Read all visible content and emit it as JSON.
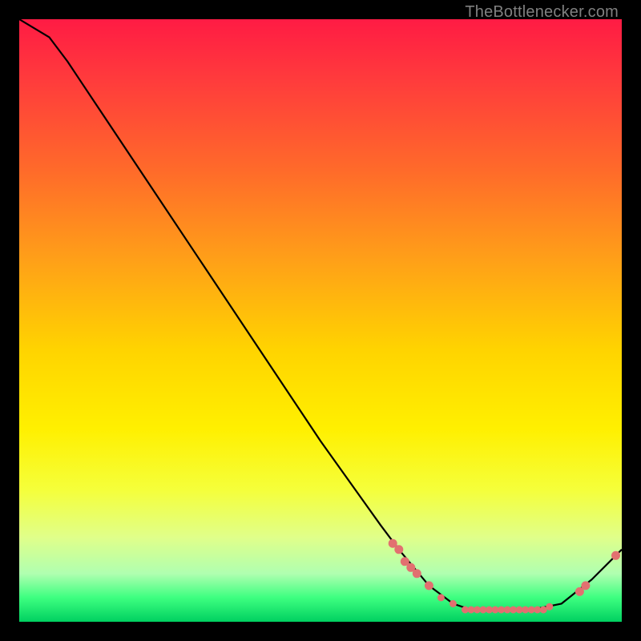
{
  "attribution": "TheBottlenecker.com",
  "chart_data": {
    "type": "line",
    "title": "",
    "xlabel": "",
    "ylabel": "",
    "xlim": [
      0,
      100
    ],
    "ylim": [
      0,
      100
    ],
    "curve": [
      {
        "x": 0,
        "y": 100
      },
      {
        "x": 5,
        "y": 97
      },
      {
        "x": 8,
        "y": 93
      },
      {
        "x": 10,
        "y": 90
      },
      {
        "x": 20,
        "y": 75
      },
      {
        "x": 30,
        "y": 60
      },
      {
        "x": 40,
        "y": 45
      },
      {
        "x": 50,
        "y": 30
      },
      {
        "x": 60,
        "y": 16
      },
      {
        "x": 63,
        "y": 12
      },
      {
        "x": 68,
        "y": 6
      },
      {
        "x": 72,
        "y": 3
      },
      {
        "x": 75,
        "y": 2
      },
      {
        "x": 80,
        "y": 2
      },
      {
        "x": 85,
        "y": 2
      },
      {
        "x": 90,
        "y": 3
      },
      {
        "x": 95,
        "y": 7
      },
      {
        "x": 98,
        "y": 10
      },
      {
        "x": 100,
        "y": 12
      }
    ],
    "markers": [
      {
        "x": 62,
        "y": 13,
        "r": 5
      },
      {
        "x": 63,
        "y": 12,
        "r": 5
      },
      {
        "x": 64,
        "y": 10,
        "r": 5
      },
      {
        "x": 65,
        "y": 9,
        "r": 5
      },
      {
        "x": 66,
        "y": 8,
        "r": 5
      },
      {
        "x": 68,
        "y": 6,
        "r": 5
      },
      {
        "x": 70,
        "y": 4,
        "r": 4
      },
      {
        "x": 72,
        "y": 3,
        "r": 4
      },
      {
        "x": 74,
        "y": 2,
        "r": 4
      },
      {
        "x": 75,
        "y": 2,
        "r": 4
      },
      {
        "x": 76,
        "y": 2,
        "r": 4
      },
      {
        "x": 77,
        "y": 2,
        "r": 4
      },
      {
        "x": 78,
        "y": 2,
        "r": 4
      },
      {
        "x": 79,
        "y": 2,
        "r": 4
      },
      {
        "x": 80,
        "y": 2,
        "r": 4
      },
      {
        "x": 81,
        "y": 2,
        "r": 4
      },
      {
        "x": 82,
        "y": 2,
        "r": 4
      },
      {
        "x": 83,
        "y": 2,
        "r": 4
      },
      {
        "x": 84,
        "y": 2,
        "r": 4
      },
      {
        "x": 85,
        "y": 2,
        "r": 4
      },
      {
        "x": 86,
        "y": 2,
        "r": 4
      },
      {
        "x": 87,
        "y": 2,
        "r": 4
      },
      {
        "x": 88,
        "y": 2.5,
        "r": 4
      },
      {
        "x": 93,
        "y": 5,
        "r": 5
      },
      {
        "x": 94,
        "y": 6,
        "r": 5
      },
      {
        "x": 99,
        "y": 11,
        "r": 5
      }
    ]
  }
}
